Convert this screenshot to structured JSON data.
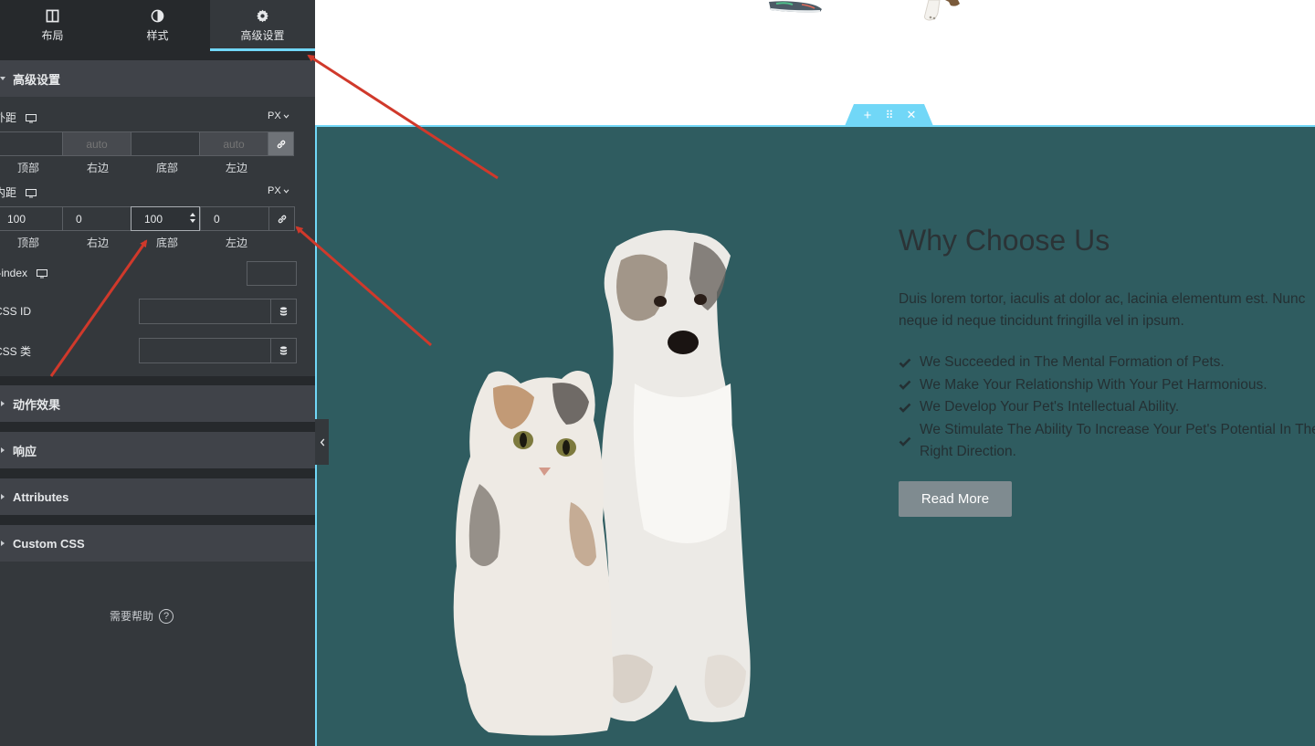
{
  "tabs": [
    {
      "label": "布局",
      "icon": "layout-columns-icon"
    },
    {
      "label": "样式",
      "icon": "contrast-half-icon"
    },
    {
      "label": "高级设置",
      "icon": "gear-icon"
    }
  ],
  "active_tab": "高级设置",
  "advanced": {
    "heading": "高级设置",
    "margin": {
      "label": "外距",
      "unit": "PX",
      "values": {
        "top": "",
        "right": "",
        "bottom": "",
        "left": ""
      },
      "placeholders": {
        "top": "",
        "right": "auto",
        "bottom": "",
        "left": "auto"
      }
    },
    "padding": {
      "label": "内距",
      "unit": "PX",
      "values": {
        "top": "100",
        "right": "0",
        "bottom": "100",
        "left": "0"
      }
    },
    "dim_labels": {
      "top": "顶部",
      "right": "右边",
      "bottom": "底部",
      "left": "左边"
    },
    "zindex_label": "Z-index",
    "css_id_label": "CSS ID",
    "css_class_label": "CSS 类"
  },
  "sections": [
    "动作效果",
    "响应",
    "Attributes",
    "Custom CSS"
  ],
  "help_label": "需要帮助",
  "help_symbol": "?",
  "section_toolbar": {
    "add": "+",
    "drag": "⠿",
    "close": "✕"
  },
  "content": {
    "title": "Why Choose Us",
    "description": "Duis lorem tortor, iaculis at dolor ac, lacinia elementum est. Nunc neque id neque tincidunt fringilla vel in ipsum.",
    "checks": [
      "We Succeeded in The Mental Formation of Pets.",
      "We Make Your Relationship With Your Pet Harmonious.",
      "We Develop Your Pet's Intellectual Ability.",
      "We Stimulate The Ability To Increase Your Pet's Potential In The Right Direction."
    ],
    "button": "Read More"
  },
  "colors": {
    "panel": "#34383c",
    "accent": "#71d7f7",
    "teal_bg": "#2f5c60",
    "annotation": "#d0392b"
  }
}
